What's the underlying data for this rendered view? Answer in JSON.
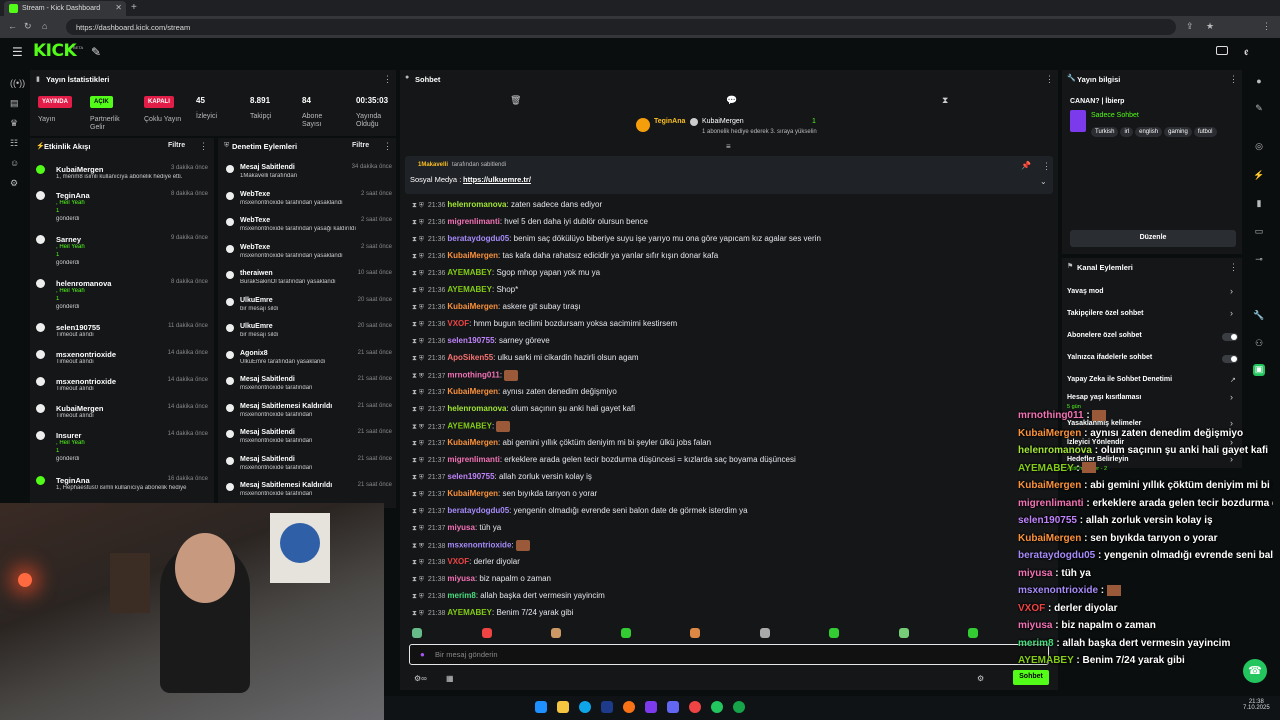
{
  "browser": {
    "tab_title": "Stream - Kick Dashboard",
    "url": "https://dashboard.kick.com/stream"
  },
  "kick": {
    "logo": "KICK",
    "beta": "BETA"
  },
  "stats": {
    "title": "Yayın İstatistikleri",
    "items": [
      {
        "badge": "YAYINDA",
        "badge_color": "#e11d48",
        "label": "Yayın"
      },
      {
        "badge": "AÇIK",
        "badge_color": "#53fc18",
        "label": "Partnerlik Gelir"
      },
      {
        "badge": "KAPALI",
        "badge_color": "#e11d48",
        "label": "Çoklu Yayın"
      },
      {
        "value": "45",
        "label": "İzleyici"
      },
      {
        "value": "8.891",
        "label": "Takipçi"
      },
      {
        "value": "84",
        "label": "Abone Sayısı"
      },
      {
        "value": "00:35:03",
        "label": "Yayında Olduğu"
      }
    ]
  },
  "events": {
    "title": "Etkinlik Akışı",
    "filter": "Filtre",
    "rows": [
      {
        "name": "KubaiMergen",
        "time": "3 dakika önce",
        "sub": "1, merim8 isimli kullanıcıya abonelik hediye etti."
      },
      {
        "name": "TeginAna",
        "time": "8 dakika önce",
        "sub": ", Heil Yeah",
        "count": "1",
        "sub2": "gönderdi"
      },
      {
        "name": "Sarney",
        "time": "9 dakika önce",
        "sub": ", Heil Yeah",
        "count": "1",
        "sub2": "gönderdi"
      },
      {
        "name": "helenromanova",
        "time": "8 dakika önce",
        "sub": ", Heil Yeah",
        "count": "1",
        "sub2": "gönderdi"
      },
      {
        "name": "selen190755",
        "time": "11 dakika önce",
        "sub": "Timeout alındı"
      },
      {
        "name": "msxenontrioxide",
        "time": "14 dakika önce",
        "sub": "Timeout alındı"
      },
      {
        "name": "msxenontrioxide",
        "time": "14 dakika önce",
        "sub": "Timeout alındı"
      },
      {
        "name": "KubaiMergen",
        "time": "14 dakika önce",
        "sub": "Timeout alındı"
      },
      {
        "name": "Insurer",
        "time": "14 dakika önce",
        "sub": ", Heil Yeah",
        "count": "1",
        "sub2": "gönderdi"
      },
      {
        "name": "TeginAna",
        "time": "16 dakika önce",
        "sub": "1, Hephaestus0 isimli kullanıcıya abonelik hediye"
      }
    ]
  },
  "moderation": {
    "title": "Denetim Eylemleri",
    "filter": "Filtre",
    "rows": [
      {
        "name": "Mesaj Sabitlendi",
        "time": "34 dakika önce",
        "sub": "1Makavelli tarafından"
      },
      {
        "name": "WebTexe",
        "time": "2 saat önce",
        "sub": "msxenontrioxide tarafından yasaklandı"
      },
      {
        "name": "WebTexe",
        "time": "2 saat önce",
        "sub": "msxenontrioxide tarafından yasağı kaldırıldı"
      },
      {
        "name": "WebTexe",
        "time": "2 saat önce",
        "sub": "msxenontrioxide tarafından yasaklandı"
      },
      {
        "name": "theraiwen",
        "time": "10 saat önce",
        "sub": "BurakSakinOl tarafından yasaklandı"
      },
      {
        "name": "UlkuEmre",
        "time": "20 saat önce",
        "sub": "bir mesajı sildi"
      },
      {
        "name": "UlkuEmre",
        "time": "20 saat önce",
        "sub": "bir mesajı sildi"
      },
      {
        "name": "Agonix8",
        "time": "21 saat önce",
        "sub": "UlkuEmre tarafından yasaklandı"
      },
      {
        "name": "Mesaj Sabitlendi",
        "time": "21 saat önce",
        "sub": "msxenontrioxide tarafından"
      },
      {
        "name": "Mesaj Sabitlemesi Kaldırıldı",
        "time": "21 saat önce",
        "sub": "msxenontrioxide tarafından"
      },
      {
        "name": "Mesaj Sabitlendi",
        "time": "21 saat önce",
        "sub": "msxenontrioxide tarafından"
      },
      {
        "name": "Mesaj Sabitlendi",
        "time": "21 saat önce",
        "sub": "msxenontrioxide tarafından"
      },
      {
        "name": "Mesaj Sabitlemesi Kaldırıldı",
        "time": "21 saat önce",
        "sub": "msxenontrioxide tarafından"
      }
    ]
  },
  "chat": {
    "title": "Sohbet",
    "gift": {
      "giver": "TeginAna",
      "receiver": "KubaiMergen",
      "count": "1",
      "text": "1 abonelik hediye ederek 3. sıraya yükselin"
    },
    "pinned": {
      "by": "1Makavelli",
      "by_suffix": "tarafından sabitlendi",
      "label": "Sosyal Medya :",
      "link": "https://ulkuemre.tr/"
    },
    "messages": [
      {
        "time": "21:36",
        "user": "helenromanova",
        "color": "#a3e635",
        "text": "zaten sadece dans ediyor"
      },
      {
        "time": "21:36",
        "user": "migrenlimanti",
        "color": "#f472b6",
        "text": "hvel 5 den daha iyi dublör olursun bence"
      },
      {
        "time": "21:36",
        "user": "berataydogdu05",
        "color": "#a78bfa",
        "text": "benim saç dökülüyo biberiye suyu işe yarıyo mu ona göre yapıcam kız agalar ses verin"
      },
      {
        "time": "21:36",
        "user": "KubaiMergen",
        "color": "#fb923c",
        "text": "tas kafa daha rahatsız edicidir ya yanlar sıfır kışın donar kafa"
      },
      {
        "time": "21:36",
        "user": "AYEMABEY",
        "color": "#84cc16",
        "text": "Sgop mhop yapan yok mu ya"
      },
      {
        "time": "21:36",
        "user": "AYEMABEY",
        "color": "#84cc16",
        "text": "Shop*"
      },
      {
        "time": "21:36",
        "user": "KubaiMergen",
        "color": "#fb923c",
        "text": "askere git subay tıraşı"
      },
      {
        "time": "21:36",
        "user": "VXOF",
        "color": "#ef4444",
        "text": "hmm bugun tecilimi bozdursam yoksa sacimimi kestirsem"
      },
      {
        "time": "21:36",
        "user": "selen190755",
        "color": "#c084fc",
        "text": "sarney göreve"
      },
      {
        "time": "21:36",
        "user": "ApoSiken55",
        "color": "#f87171",
        "text": "ulku sarki mi cikardin hazirli olsun agam"
      },
      {
        "time": "21:37",
        "user": "mrnothing011",
        "color": "#f472b6",
        "text": "[emote]"
      },
      {
        "time": "21:37",
        "user": "KubaiMergen",
        "color": "#fb923c",
        "text": "aynısı zaten denedim değişmiyo"
      },
      {
        "time": "21:37",
        "user": "helenromanova",
        "color": "#a3e635",
        "text": "olum saçının şu anki hali gayet kafi"
      },
      {
        "time": "21:37",
        "user": "AYEMABEY",
        "color": "#84cc16",
        "text": "[emote]"
      },
      {
        "time": "21:37",
        "user": "KubaiMergen",
        "color": "#fb923c",
        "text": "abi gemini yıllık çöktüm deniyim mi bi şeyler ülkü jobs falan"
      },
      {
        "time": "21:37",
        "user": "migrenlimanti",
        "color": "#f472b6",
        "text": "erkeklere arada gelen tecir bozdurma düşüncesi = kızlarda saç boyama düşüncesi"
      },
      {
        "time": "21:37",
        "user": "selen190755",
        "color": "#c084fc",
        "text": "allah zorluk versin kolay iş"
      },
      {
        "time": "21:37",
        "user": "KubaiMergen",
        "color": "#fb923c",
        "text": "sen bıyıkda tarıyon o yorar"
      },
      {
        "time": "21:37",
        "user": "berataydogdu05",
        "color": "#a78bfa",
        "text": "yengenin olmadığı evrende seni balon date de görmek isterdim ya"
      },
      {
        "time": "21:37",
        "user": "miyusa",
        "color": "#f472b6",
        "text": "tüh ya"
      },
      {
        "time": "21:38",
        "user": "msxenontrioxide",
        "color": "#a78bfa",
        "text": "[emote]"
      },
      {
        "time": "21:38",
        "user": "VXOF",
        "color": "#ef4444",
        "text": "derler diyolar"
      },
      {
        "time": "21:38",
        "user": "miyusa",
        "color": "#f472b6",
        "text": "biz napalm o zaman"
      },
      {
        "time": "21:38",
        "user": "merim8",
        "color": "#4ade80",
        "text": "allah başka dert vermesin yayincim"
      },
      {
        "time": "21:38",
        "user": "AYEMABEY",
        "color": "#84cc16",
        "text": "Benim 7/24 yarak gibi"
      }
    ],
    "input_placeholder": "Bir mesaj gönderin",
    "send_label": "Sohbet"
  },
  "stream_info": {
    "title": "Yayın bilgisi",
    "stream_title": "CANAN? | İbierp",
    "category": "Sadece Sohbet",
    "tags": [
      "Turkish",
      "irl",
      "english",
      "gaming",
      "futbol"
    ],
    "edit_label": "Düzenle"
  },
  "channel_actions": {
    "title": "Kanal Eylemleri",
    "items": [
      {
        "label": "Yavaş mod",
        "kind": "chevron"
      },
      {
        "label": "Takipçilere özel sohbet",
        "kind": "chevron"
      },
      {
        "label": "Abonelere özel sohbet",
        "kind": "toggle"
      },
      {
        "label": "Yalnızca ifadelerle sohbet",
        "kind": "toggle"
      },
      {
        "label": "Yapay Zeka ile Sohbet Denetimi",
        "kind": "link"
      },
      {
        "label": "Hesap yaşı kısıtlaması",
        "kind": "chevron",
        "sub": "5 gün"
      },
      {
        "label": "Yasaklanmış kelimeler",
        "kind": "chevron"
      },
      {
        "label": "İzleyici Yönlendir",
        "kind": "chevron"
      },
      {
        "label": "Hedefler Belirleyin",
        "kind": "chevron",
        "sub": "Aktif hedefler - 2"
      }
    ]
  },
  "overlay": {
    "lines": [
      {
        "user": "mrnothing011",
        "color": "#f472b6",
        "text": ""
      },
      {
        "user": "KubaiMergen",
        "color": "#fb923c",
        "text": "aynısı zaten denedim değişmiyo"
      },
      {
        "user": "helenromanova",
        "color": "#a3e635",
        "text": "olum saçının şu anki hali gayet kafi"
      },
      {
        "user": "AYEMABEY",
        "color": "#84cc16",
        "text": ""
      },
      {
        "user": "KubaiMergen",
        "color": "#fb923c",
        "text": "abi gemini yıllık çöktüm deniyim mi bi şeyler ülkü jobs falan"
      },
      {
        "user": "migrenlimanti",
        "color": "#f472b6",
        "text": "erkeklere arada gelen tecir bozdurma düşüncesi = kızlarda saç boyama düşüncesi"
      },
      {
        "user": "selen190755",
        "color": "#c084fc",
        "text": "allah zorluk versin kolay iş"
      },
      {
        "user": "KubaiMergen",
        "color": "#fb923c",
        "text": "sen bıyıkda tarıyon o yorar"
      },
      {
        "user": "berataydogdu05",
        "color": "#a78bfa",
        "text": "yengenin olmadığı evrende seni balon date de görmek isterdim ya"
      },
      {
        "user": "miyusa",
        "color": "#f472b6",
        "text": "tüh ya"
      },
      {
        "user": "msxenontrioxide",
        "color": "#a78bfa",
        "text": ""
      },
      {
        "user": "VXOF",
        "color": "#ef4444",
        "text": "derler diyolar"
      },
      {
        "user": "miyusa",
        "color": "#f472b6",
        "text": "biz napalm o zaman"
      },
      {
        "user": "merim8",
        "color": "#4ade80",
        "text": "allah başka dert vermesin yayincim"
      },
      {
        "user": "AYEMABEY",
        "color": "#84cc16",
        "text": "Benim 7/24 yarak gibi"
      }
    ]
  },
  "taskbar": {
    "time": "21:38",
    "date": "7.10.2025"
  }
}
